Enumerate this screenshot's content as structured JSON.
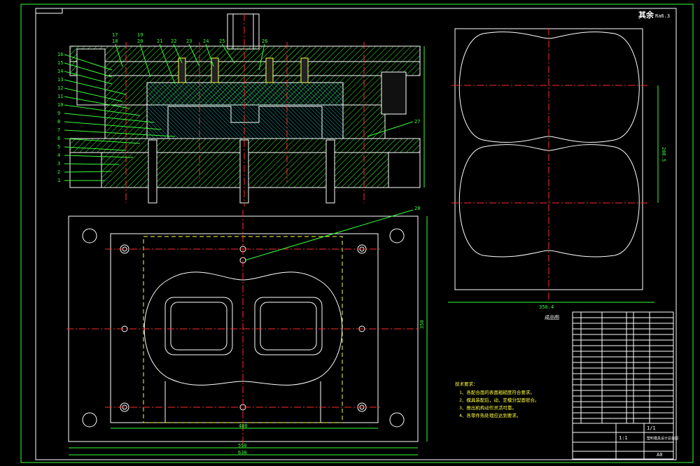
{
  "roughness_note": "其余",
  "roughness_value": "Ra6.3",
  "part_numbers_left": [
    "16",
    "15",
    "14",
    "13",
    "12",
    "11",
    "10",
    "9",
    "8",
    "7",
    "6",
    "5",
    "4",
    "3",
    "2",
    "1"
  ],
  "part_numbers_top": [
    "17",
    "18",
    "19",
    "20",
    "21",
    "22",
    "23",
    "24",
    "25",
    "26"
  ],
  "part_number_right": "27",
  "part_number_plan": "28",
  "section_view_label": "成品图",
  "tech_requirements": {
    "title": "技术要求：",
    "items": [
      "1、各配合面的表面粗糙度符合要求。",
      "2、模具装配后，动、定模分型面密合。",
      "3、推出机构动作灵活可靠。",
      "4、各零件热处理应达到要求。"
    ]
  },
  "dimensions": {
    "plan_width_inner": "400",
    "plan_width_outer1": "550",
    "plan_width_outer2": "630",
    "plan_height": "350",
    "part_width": "356.4",
    "part_height": "208.5"
  },
  "title_block": {
    "drawing_name": "塑料模具设计总装图",
    "scale": "1:1",
    "sheet": "1/1",
    "mark": "A0"
  }
}
